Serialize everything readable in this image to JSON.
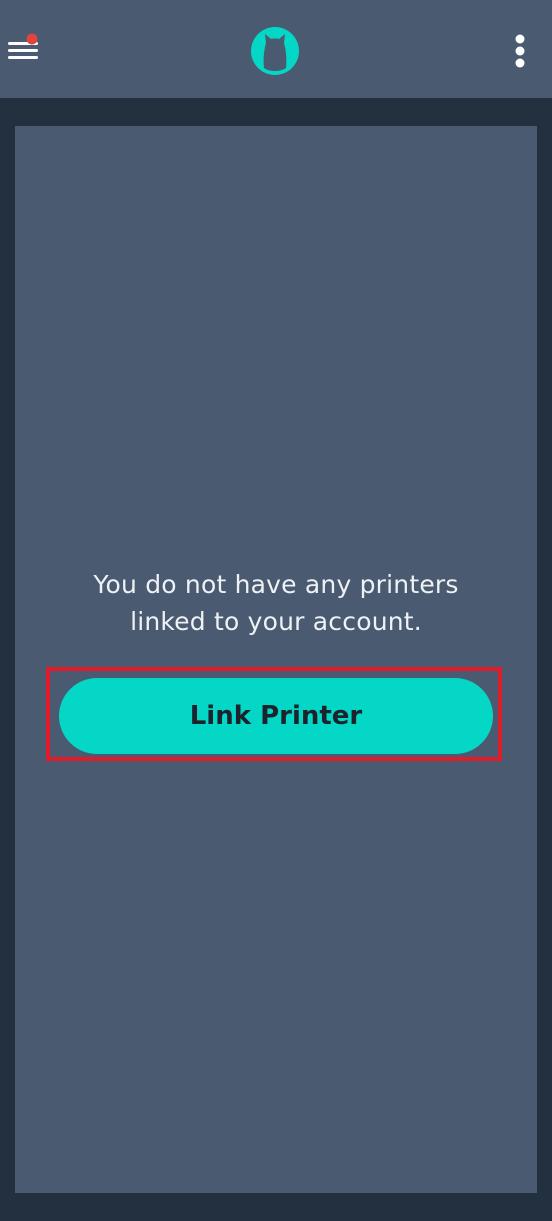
{
  "header": {
    "menu_icon": "hamburger-menu-icon",
    "notification_dot_color": "#e0443a",
    "logo_icon": "cat-logo-icon",
    "logo_color": "#05d7c6",
    "more_icon": "vertical-dots-icon"
  },
  "empty_state": {
    "line1": "You do not have any printers",
    "line2": "linked to your account.",
    "button_label": "Link Printer",
    "button_color": "#05d7c6",
    "highlight_color": "#e01b2a"
  }
}
